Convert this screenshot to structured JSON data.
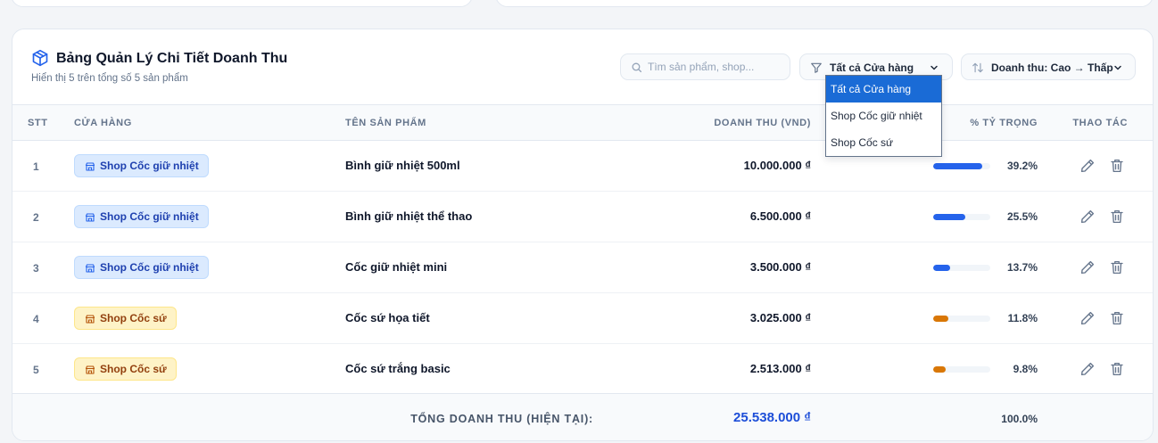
{
  "header": {
    "title": "Bảng Quản Lý Chi Tiết Doanh Thu",
    "subtitle": "Hiển thị 5 trên tổng số 5 sản phẩm"
  },
  "search": {
    "placeholder": "Tìm sản phẩm, shop..."
  },
  "filter": {
    "selected": "Tất cả Cửa hàng",
    "options": [
      "Tất cả Cửa hàng",
      "Shop Cốc giữ nhiệt",
      "Shop Cốc sứ"
    ]
  },
  "sort": {
    "label": "Doanh thu: Cao → Thấp"
  },
  "columns": [
    "STT",
    "CỬA HÀNG",
    "TÊN SẢN PHẨM",
    "DOANH THU (VND)",
    "% TỶ TRỌNG",
    "THAO TÁC"
  ],
  "rows": [
    {
      "stt": "1",
      "shop": "Shop Cốc giữ nhiệt",
      "product": "Bình giữ nhiệt 500ml",
      "revenue": "10.000.000 ₫",
      "share": "39.2%",
      "share_value": 39.2
    },
    {
      "stt": "2",
      "shop": "Shop Cốc giữ nhiệt",
      "product": "Bình giữ nhiệt thể thao",
      "revenue": "6.500.000 ₫",
      "share": "25.5%",
      "share_value": 25.5
    },
    {
      "stt": "3",
      "shop": "Shop Cốc giữ nhiệt",
      "product": "Cốc giữ nhiệt mini",
      "revenue": "3.500.000 ₫",
      "share": "13.7%",
      "share_value": 13.7
    },
    {
      "stt": "4",
      "shop": "Shop Cốc sứ",
      "product": "Cốc sứ họa tiết",
      "revenue": "3.025.000 ₫",
      "share": "11.8%",
      "share_value": 11.8
    },
    {
      "stt": "5",
      "shop": "Shop Cốc sứ",
      "product": "Cốc sứ trắng basic",
      "revenue": "2.513.000 ₫",
      "share": "9.8%",
      "share_value": 9.8
    }
  ],
  "footer": {
    "total_label": "TỔNG DOANH THU (HIỆN TẠI):",
    "total_value": "25.538.000 ₫",
    "total_share": "100.0%"
  },
  "colors": {
    "accent": "#2563eb",
    "shop_blue": "#2563eb",
    "shop_orange": "#d97706",
    "dropdown_selected": "#1a6bd6"
  },
  "icons": {
    "title": "box-icon",
    "search": "search-icon",
    "filter": "filter-icon",
    "sort": "sort-arrows-icon",
    "shop": "store-icon",
    "edit": "pencil-icon",
    "delete": "trash-icon"
  }
}
